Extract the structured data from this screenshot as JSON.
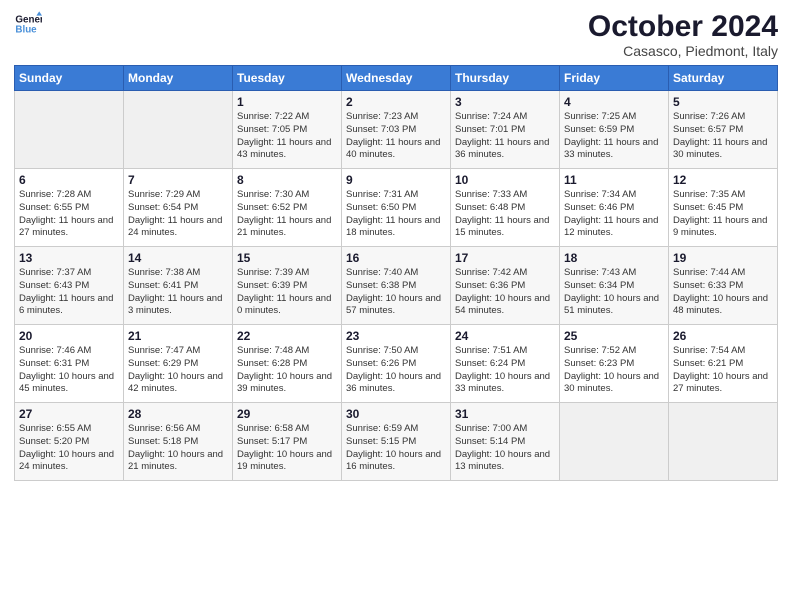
{
  "logo": {
    "line1": "General",
    "line2": "Blue"
  },
  "title": "October 2024",
  "subtitle": "Casasco, Piedmont, Italy",
  "days_of_week": [
    "Sunday",
    "Monday",
    "Tuesday",
    "Wednesday",
    "Thursday",
    "Friday",
    "Saturday"
  ],
  "weeks": [
    [
      {
        "day": "",
        "sunrise": "",
        "sunset": "",
        "daylight": ""
      },
      {
        "day": "",
        "sunrise": "",
        "sunset": "",
        "daylight": ""
      },
      {
        "day": "1",
        "sunrise": "Sunrise: 7:22 AM",
        "sunset": "Sunset: 7:05 PM",
        "daylight": "Daylight: 11 hours and 43 minutes."
      },
      {
        "day": "2",
        "sunrise": "Sunrise: 7:23 AM",
        "sunset": "Sunset: 7:03 PM",
        "daylight": "Daylight: 11 hours and 40 minutes."
      },
      {
        "day": "3",
        "sunrise": "Sunrise: 7:24 AM",
        "sunset": "Sunset: 7:01 PM",
        "daylight": "Daylight: 11 hours and 36 minutes."
      },
      {
        "day": "4",
        "sunrise": "Sunrise: 7:25 AM",
        "sunset": "Sunset: 6:59 PM",
        "daylight": "Daylight: 11 hours and 33 minutes."
      },
      {
        "day": "5",
        "sunrise": "Sunrise: 7:26 AM",
        "sunset": "Sunset: 6:57 PM",
        "daylight": "Daylight: 11 hours and 30 minutes."
      }
    ],
    [
      {
        "day": "6",
        "sunrise": "Sunrise: 7:28 AM",
        "sunset": "Sunset: 6:55 PM",
        "daylight": "Daylight: 11 hours and 27 minutes."
      },
      {
        "day": "7",
        "sunrise": "Sunrise: 7:29 AM",
        "sunset": "Sunset: 6:54 PM",
        "daylight": "Daylight: 11 hours and 24 minutes."
      },
      {
        "day": "8",
        "sunrise": "Sunrise: 7:30 AM",
        "sunset": "Sunset: 6:52 PM",
        "daylight": "Daylight: 11 hours and 21 minutes."
      },
      {
        "day": "9",
        "sunrise": "Sunrise: 7:31 AM",
        "sunset": "Sunset: 6:50 PM",
        "daylight": "Daylight: 11 hours and 18 minutes."
      },
      {
        "day": "10",
        "sunrise": "Sunrise: 7:33 AM",
        "sunset": "Sunset: 6:48 PM",
        "daylight": "Daylight: 11 hours and 15 minutes."
      },
      {
        "day": "11",
        "sunrise": "Sunrise: 7:34 AM",
        "sunset": "Sunset: 6:46 PM",
        "daylight": "Daylight: 11 hours and 12 minutes."
      },
      {
        "day": "12",
        "sunrise": "Sunrise: 7:35 AM",
        "sunset": "Sunset: 6:45 PM",
        "daylight": "Daylight: 11 hours and 9 minutes."
      }
    ],
    [
      {
        "day": "13",
        "sunrise": "Sunrise: 7:37 AM",
        "sunset": "Sunset: 6:43 PM",
        "daylight": "Daylight: 11 hours and 6 minutes."
      },
      {
        "day": "14",
        "sunrise": "Sunrise: 7:38 AM",
        "sunset": "Sunset: 6:41 PM",
        "daylight": "Daylight: 11 hours and 3 minutes."
      },
      {
        "day": "15",
        "sunrise": "Sunrise: 7:39 AM",
        "sunset": "Sunset: 6:39 PM",
        "daylight": "Daylight: 11 hours and 0 minutes."
      },
      {
        "day": "16",
        "sunrise": "Sunrise: 7:40 AM",
        "sunset": "Sunset: 6:38 PM",
        "daylight": "Daylight: 10 hours and 57 minutes."
      },
      {
        "day": "17",
        "sunrise": "Sunrise: 7:42 AM",
        "sunset": "Sunset: 6:36 PM",
        "daylight": "Daylight: 10 hours and 54 minutes."
      },
      {
        "day": "18",
        "sunrise": "Sunrise: 7:43 AM",
        "sunset": "Sunset: 6:34 PM",
        "daylight": "Daylight: 10 hours and 51 minutes."
      },
      {
        "day": "19",
        "sunrise": "Sunrise: 7:44 AM",
        "sunset": "Sunset: 6:33 PM",
        "daylight": "Daylight: 10 hours and 48 minutes."
      }
    ],
    [
      {
        "day": "20",
        "sunrise": "Sunrise: 7:46 AM",
        "sunset": "Sunset: 6:31 PM",
        "daylight": "Daylight: 10 hours and 45 minutes."
      },
      {
        "day": "21",
        "sunrise": "Sunrise: 7:47 AM",
        "sunset": "Sunset: 6:29 PM",
        "daylight": "Daylight: 10 hours and 42 minutes."
      },
      {
        "day": "22",
        "sunrise": "Sunrise: 7:48 AM",
        "sunset": "Sunset: 6:28 PM",
        "daylight": "Daylight: 10 hours and 39 minutes."
      },
      {
        "day": "23",
        "sunrise": "Sunrise: 7:50 AM",
        "sunset": "Sunset: 6:26 PM",
        "daylight": "Daylight: 10 hours and 36 minutes."
      },
      {
        "day": "24",
        "sunrise": "Sunrise: 7:51 AM",
        "sunset": "Sunset: 6:24 PM",
        "daylight": "Daylight: 10 hours and 33 minutes."
      },
      {
        "day": "25",
        "sunrise": "Sunrise: 7:52 AM",
        "sunset": "Sunset: 6:23 PM",
        "daylight": "Daylight: 10 hours and 30 minutes."
      },
      {
        "day": "26",
        "sunrise": "Sunrise: 7:54 AM",
        "sunset": "Sunset: 6:21 PM",
        "daylight": "Daylight: 10 hours and 27 minutes."
      }
    ],
    [
      {
        "day": "27",
        "sunrise": "Sunrise: 6:55 AM",
        "sunset": "Sunset: 5:20 PM",
        "daylight": "Daylight: 10 hours and 24 minutes."
      },
      {
        "day": "28",
        "sunrise": "Sunrise: 6:56 AM",
        "sunset": "Sunset: 5:18 PM",
        "daylight": "Daylight: 10 hours and 21 minutes."
      },
      {
        "day": "29",
        "sunrise": "Sunrise: 6:58 AM",
        "sunset": "Sunset: 5:17 PM",
        "daylight": "Daylight: 10 hours and 19 minutes."
      },
      {
        "day": "30",
        "sunrise": "Sunrise: 6:59 AM",
        "sunset": "Sunset: 5:15 PM",
        "daylight": "Daylight: 10 hours and 16 minutes."
      },
      {
        "day": "31",
        "sunrise": "Sunrise: 7:00 AM",
        "sunset": "Sunset: 5:14 PM",
        "daylight": "Daylight: 10 hours and 13 minutes."
      },
      {
        "day": "",
        "sunrise": "",
        "sunset": "",
        "daylight": ""
      },
      {
        "day": "",
        "sunrise": "",
        "sunset": "",
        "daylight": ""
      }
    ]
  ]
}
